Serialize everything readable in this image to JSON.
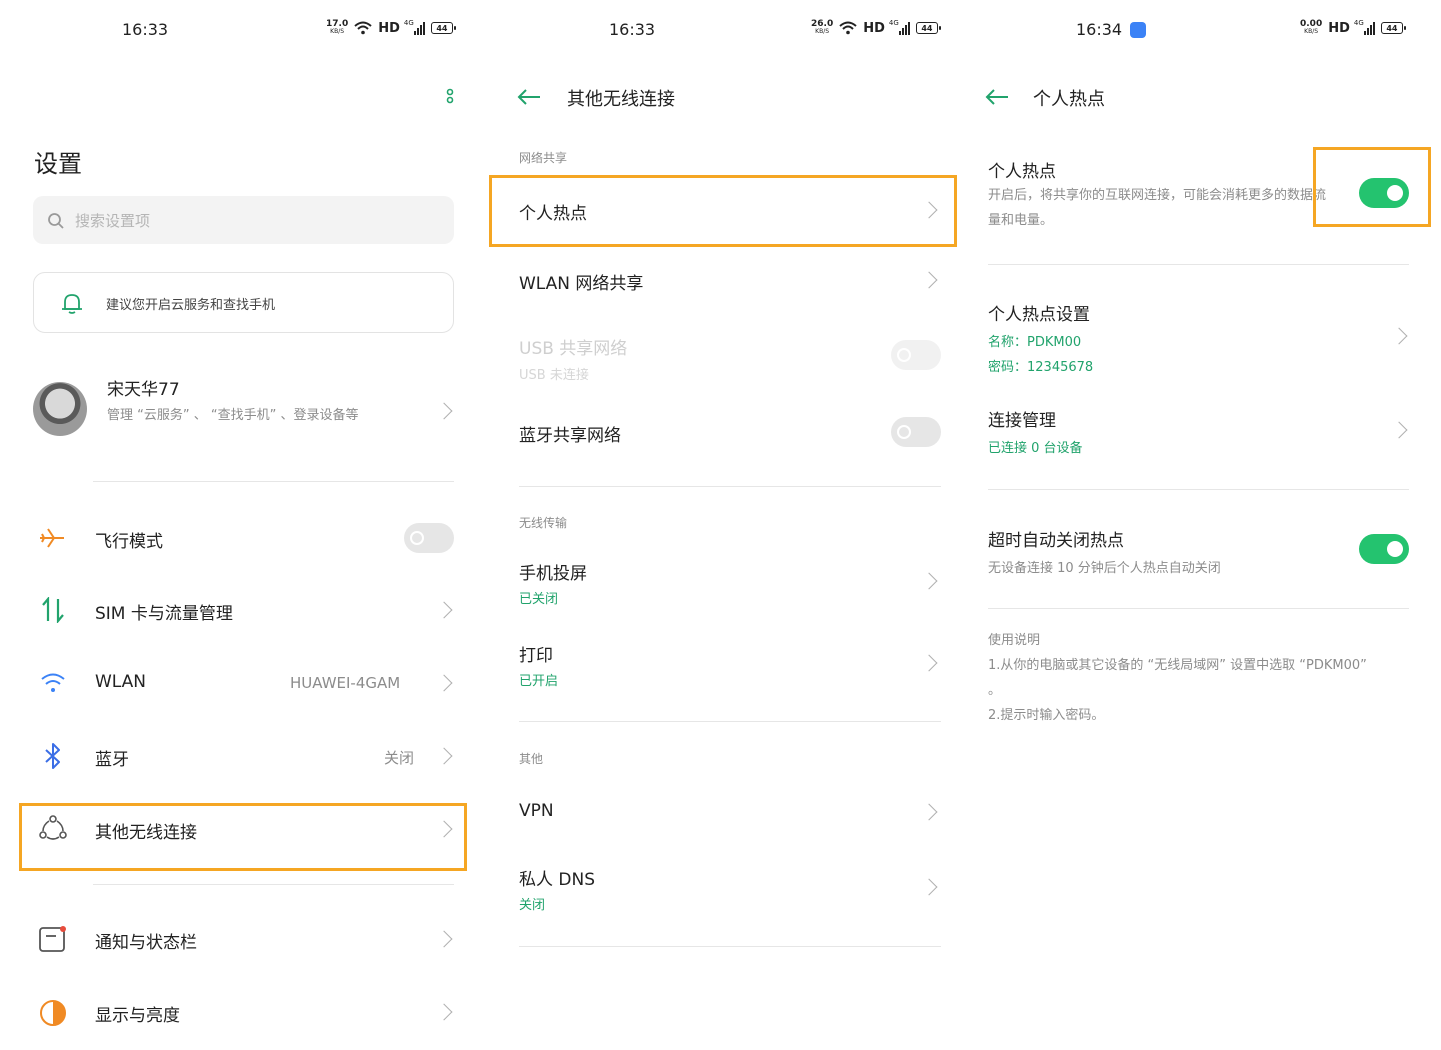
{
  "panel1": {
    "status": {
      "time": "16:33",
      "speed": "17.0",
      "speed_unit": "KB/S",
      "hd": "HD",
      "net": "4G",
      "battery": "44"
    },
    "title": "设置",
    "search_placeholder": "搜索设置项",
    "cloud_banner": "建议您开启云服务和查找手机",
    "account": {
      "name": "宋天华77",
      "desc": "管理 “云服务” 、 “查找手机” 、登录设备等"
    },
    "items": [
      {
        "label": "飞行模式",
        "value": ""
      },
      {
        "label": "SIM 卡与流量管理",
        "value": ""
      },
      {
        "label": "WLAN",
        "value": "HUAWEI-4GAM"
      },
      {
        "label": "蓝牙",
        "value": "关闭"
      },
      {
        "label": "其他无线连接",
        "value": ""
      },
      {
        "label": "通知与状态栏",
        "value": ""
      },
      {
        "label": "显示与亮度",
        "value": ""
      }
    ],
    "colors": {
      "accent": "#21a36c",
      "highlight": "#f5a623"
    }
  },
  "panel2": {
    "status": {
      "time": "16:33",
      "speed": "26.0",
      "speed_unit": "KB/S",
      "hd": "HD",
      "net": "4G",
      "battery": "44"
    },
    "title": "其他无线连接",
    "sections": {
      "sharing": "网络共享",
      "transfer": "无线传输",
      "other": "其他"
    },
    "items": {
      "hotspot": "个人热点",
      "wlan_share": "WLAN 网络共享",
      "usb_share": "USB 共享网络",
      "usb_sub": "USB 未连接",
      "bt_share": "蓝牙共享网络",
      "cast": "手机投屏",
      "cast_sub": "已关闭",
      "print": "打印",
      "print_sub": "已开启",
      "vpn": "VPN",
      "dns": "私人 DNS",
      "dns_sub": "关闭"
    }
  },
  "panel3": {
    "status": {
      "time": "16:34",
      "speed": "0.00",
      "speed_unit": "KB/S",
      "hd": "HD",
      "net": "4G",
      "battery": "44"
    },
    "title": "个人热点",
    "hotspot": {
      "label": "个人热点",
      "desc": "开启后，将共享你的互联网连接，可能会消耗更多的数据流量和电量。",
      "enabled": true
    },
    "settings": {
      "label": "个人热点设置",
      "name": "名称：PDKM00",
      "password": "密码：12345678"
    },
    "connections": {
      "label": "连接管理",
      "sub": "已连接 0 台设备"
    },
    "auto_off": {
      "label": "超时自动关闭热点",
      "sub": "无设备连接 10 分钟后个人热点自动关闭",
      "enabled": true
    },
    "instructions": {
      "title": "使用说明",
      "line1": "1.从你的电脑或其它设备的 “无线局域网” 设置中选取 “PDKM00” 。",
      "line2": "2.提示时输入密码。"
    }
  }
}
